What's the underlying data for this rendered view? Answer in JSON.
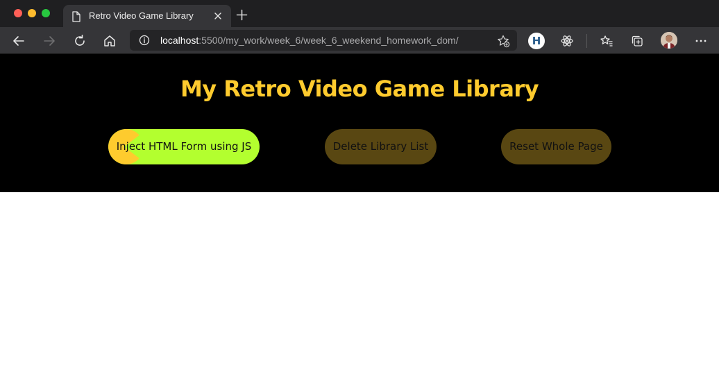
{
  "browser": {
    "tab": {
      "title": "Retro Video Game Library",
      "icon": "document-icon"
    },
    "address_bar": {
      "host": "localhost",
      "path": ":5500/my_work/week_6/week_6_weekend_homework_dom/"
    },
    "extension_badge": "H",
    "icons": [
      "back-icon",
      "forward-icon",
      "reload-icon",
      "home-icon",
      "info-icon",
      "add-favorite-icon",
      "react-icon",
      "favorites-icon",
      "collections-icon",
      "profile-avatar",
      "more-icon"
    ]
  },
  "page": {
    "title": "My Retro Video Game Library",
    "buttons": {
      "inject": "Inject HTML Form using JS",
      "delete": "Delete Library List",
      "reset": "Reset Whole Page"
    }
  },
  "colors": {
    "title": "#fecb2e",
    "inject_button": "#b3ff2f",
    "pacman": "#fecb2e",
    "muted_button": "#594712",
    "header_background": "#000000"
  }
}
